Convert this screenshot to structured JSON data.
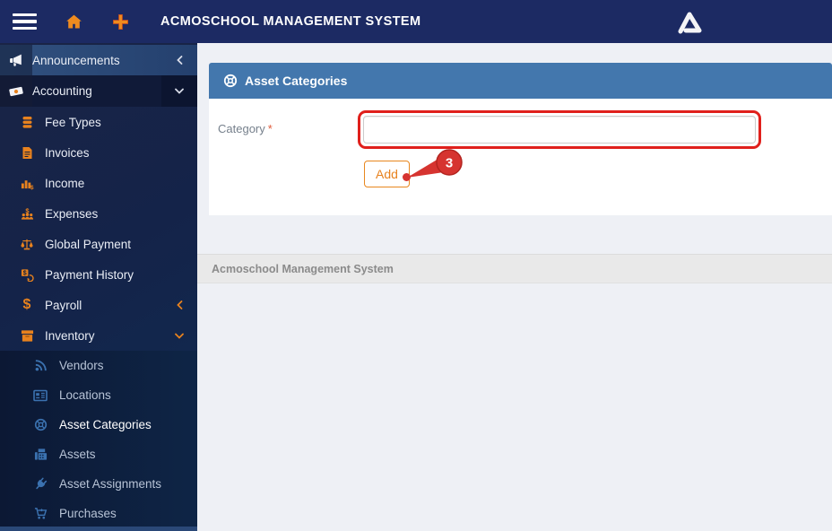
{
  "topbar": {
    "title": "ACMOSCHOOL MANAGEMENT SYSTEM"
  },
  "sidebar": {
    "items": [
      {
        "label": "Announcements",
        "icon": "megaphone-icon"
      },
      {
        "label": "Accounting",
        "icon": "money-icon"
      },
      {
        "label": "Fee Types",
        "icon": "coins-icon"
      },
      {
        "label": "Invoices",
        "icon": "invoice-icon"
      },
      {
        "label": "Income",
        "icon": "bar-chart-dollar-icon"
      },
      {
        "label": "Expenses",
        "icon": "group-dollar-icon"
      },
      {
        "label": "Global Payment",
        "icon": "balance-scale-icon"
      },
      {
        "label": "Payment History",
        "icon": "payment-history-icon"
      },
      {
        "label": "Payroll",
        "icon": "dollar-icon"
      },
      {
        "label": "Inventory",
        "icon": "box-icon"
      },
      {
        "label": "Vendors",
        "icon": "rss-icon"
      },
      {
        "label": "Locations",
        "icon": "address-card-icon"
      },
      {
        "label": "Asset Categories",
        "icon": "life-ring-icon"
      },
      {
        "label": "Assets",
        "icon": "fax-icon"
      },
      {
        "label": "Asset Assignments",
        "icon": "plug-icon"
      },
      {
        "label": "Purchases",
        "icon": "cart-icon"
      }
    ],
    "active_item": "Asset Categories"
  },
  "panel": {
    "title": "Asset Categories",
    "form": {
      "category_label": "Category",
      "required_mark": "*",
      "input_value": "",
      "add_button": "Add"
    }
  },
  "annotation": {
    "step": "3"
  },
  "footer": {
    "text": "Acmoschool Management System"
  },
  "colors": {
    "topbar": "#1c2a63",
    "accent_orange": "#e8821e",
    "panel_header_blue": "#4377ad",
    "annotation_red": "#e0201c",
    "sidebar_navy": "#14234a",
    "submenu_icon_blue": "#3b72b0"
  }
}
